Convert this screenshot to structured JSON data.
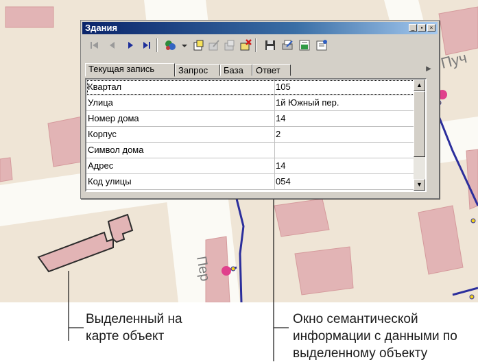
{
  "map": {
    "street_labels": [
      "Пуч",
      "Пер"
    ]
  },
  "window": {
    "title": "Здания",
    "min_symbol": "_",
    "max_symbol": "▪",
    "close_symbol": "×",
    "tabs": [
      {
        "label": "Текущая запись"
      },
      {
        "label": "Запрос"
      },
      {
        "label": "База"
      },
      {
        "label": "Ответ"
      }
    ],
    "rows": [
      {
        "key": "Квартал",
        "value": "105"
      },
      {
        "key": "Улица",
        "value": "1й Южный пер."
      },
      {
        "key": "Номер дома",
        "value": "14"
      },
      {
        "key": "Корпус",
        "value": "2"
      },
      {
        "key": "Символ дома",
        "value": ""
      },
      {
        "key": "Адрес",
        "value": "14"
      },
      {
        "key": "Код улицы",
        "value": "054"
      }
    ]
  },
  "captions": {
    "left": [
      "Выделенный на",
      "карте объект"
    ],
    "right": [
      "Окно семантической",
      "информации с данными по",
      "выделенному объекту"
    ]
  },
  "colors": {
    "map_bg": "#efe5d6",
    "road": "#fbfaf5",
    "building": "#e2b4b5",
    "building_stroke": "#d59a9c",
    "selected_stroke": "#2b2b2b",
    "blue_line": "#2b2e9c",
    "pink_node": "#e0408c",
    "yellow_node": "#f3d21b"
  }
}
